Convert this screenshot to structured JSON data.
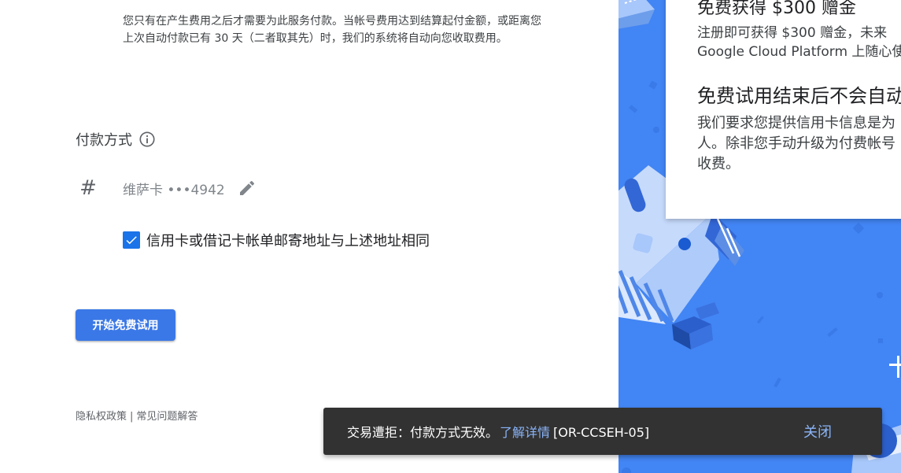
{
  "billing": {
    "description": "您只有在产生费用之后才需要为此服务付款。当帐号费用达到结算起付金额，或距离您上次自动付款已有 30 天（二者取其先）时，我们的系统将自动向您收取费用。"
  },
  "payment": {
    "title": "付款方式",
    "card_label": "维萨卡 •••4942",
    "hash_symbol": "#",
    "same_address_label": "信用卡或借记卡帐单邮寄地址与上述地址相同",
    "same_address_checked": true
  },
  "actions": {
    "start_trial_label": "开始免费试用"
  },
  "footer": {
    "privacy_label": "隐私权政策",
    "separator": "|",
    "faq_label": "常见问题解答"
  },
  "promo": {
    "heading_1": "免费获得 $300 赠金",
    "text_1": "注册即可获得 $300 赠金，未来\nGoogle Cloud Platform 上随心使",
    "heading_2": "免费试用结束后不会自动",
    "text_2": "我们要求您提供信用卡信息是为\n人。除非您手动升级为付费帐号\n收费。"
  },
  "snackbar": {
    "message": "交易遭拒：付款方式无效。",
    "link_label": "了解详情",
    "code": "[OR-CCSEH-05]",
    "close_label": "关闭"
  },
  "colors": {
    "primary_button": "#3b78e7",
    "checkbox": "#1a73e8",
    "promo_background": "#4285f4",
    "snackbar_background": "#323232",
    "snackbar_link": "#8ab4f8"
  }
}
